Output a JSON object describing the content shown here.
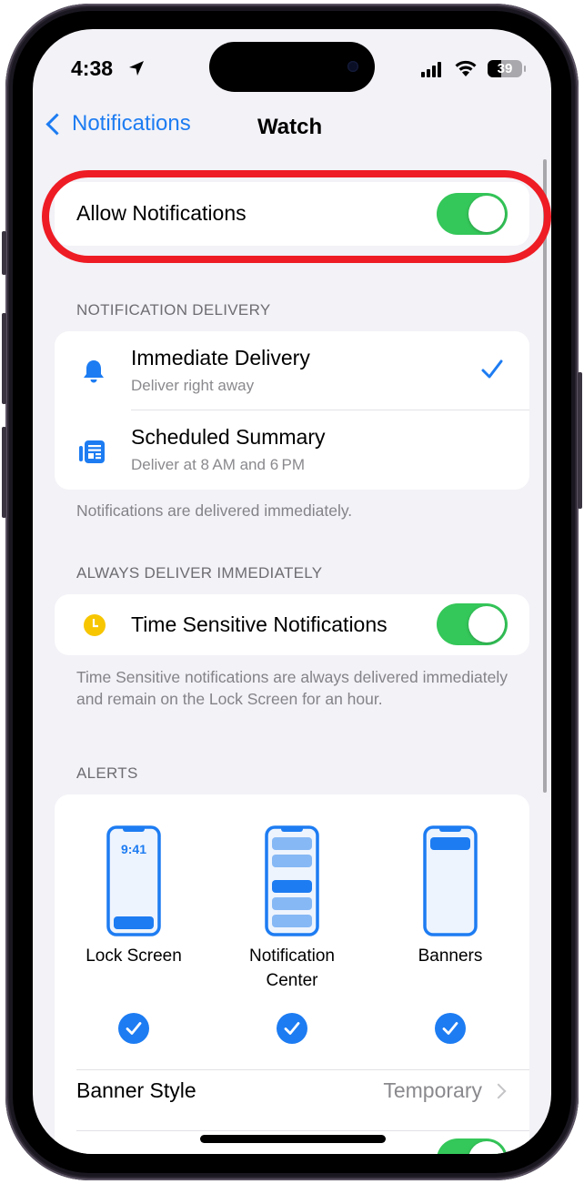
{
  "status_bar": {
    "time": "4:38",
    "battery_percent": "39",
    "battery_level": 0.39,
    "icons": [
      "location-arrow-icon",
      "cellular-signal-icon",
      "wifi-icon",
      "battery-icon"
    ]
  },
  "nav": {
    "back_label": "Notifications",
    "title": "Watch"
  },
  "allow_notifications": {
    "label": "Allow Notifications",
    "enabled": true
  },
  "notification_delivery": {
    "header": "NOTIFICATION DELIVERY",
    "options": [
      {
        "title": "Immediate Delivery",
        "subtitle": "Deliver right away",
        "icon": "bell-icon",
        "selected": true
      },
      {
        "title": "Scheduled Summary",
        "subtitle": "Deliver at 8 AM and 6 PM",
        "icon": "summary-icon",
        "selected": false
      }
    ],
    "footer": "Notifications are delivered immediately."
  },
  "always_deliver": {
    "header": "ALWAYS DELIVER IMMEDIATELY",
    "time_sensitive_label": "Time Sensitive Notifications",
    "time_sensitive_enabled": true,
    "footer": "Time Sensitive notifications are always delivered immediately and remain on the Lock Screen for an hour."
  },
  "alerts": {
    "header": "ALERTS",
    "options": [
      {
        "label": "Lock Screen",
        "checked": true,
        "preview_time": "9:41"
      },
      {
        "label": "Notification Center",
        "checked": true
      },
      {
        "label": "Banners",
        "checked": true
      }
    ],
    "banner_style_label": "Banner Style",
    "banner_style_value": "Temporary",
    "next_toggle_enabled": true
  },
  "colors": {
    "accent": "#1d7cf2",
    "toggle_on": "#34c759",
    "highlight": "#ee1c24",
    "time_sensitive_icon": "#f7c600",
    "background": "#f2f2f7"
  }
}
